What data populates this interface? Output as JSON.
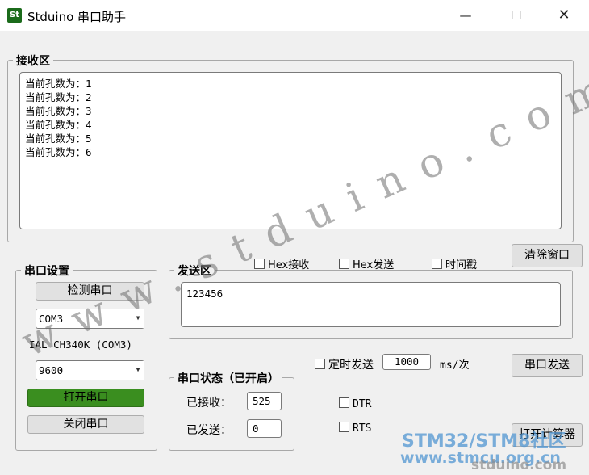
{
  "window": {
    "icon_text": "St",
    "title": "Stduino 串口助手",
    "minimize": "—",
    "maximize": "☐",
    "close": "✕"
  },
  "receive": {
    "title": "接收区",
    "lines": [
      "当前孔数为：1",
      "当前孔数为：2",
      "当前孔数为：3",
      "当前孔数为：4",
      "当前孔数为：5",
      "当前孔数为：6"
    ]
  },
  "clear_button": "清除窗口",
  "options": {
    "hex_receive": "Hex接收",
    "hex_send": "Hex发送",
    "timestamp": "时间戳"
  },
  "serial_settings": {
    "title": "串口设置",
    "detect_button": "检测串口",
    "port_value": "COM3",
    "port_description": "IAL CH340K (COM3)",
    "baud_value": "9600",
    "open_button": "打开串口",
    "close_button": "关闭串口"
  },
  "send": {
    "title": "发送区",
    "text": "123456"
  },
  "timed_send": {
    "label": "定时发送",
    "interval": "1000",
    "unit": "ms/次"
  },
  "send_button": "串口发送",
  "status": {
    "title": "串口状态（已开启）",
    "received_label": "已接收：",
    "received_value": "525",
    "sent_label": "已发送：",
    "sent_value": "0"
  },
  "signals": {
    "dtr": "DTR",
    "rts": "RTS"
  },
  "calculator_button": "打开计算器",
  "watermarks": {
    "diagonal": "www.stduino.com",
    "site_line1": "STM32/STM8社区",
    "site_line2": "www.stmcu.org.cn",
    "site_line3": "stduino.com"
  },
  "colors": {
    "open_button_bg": "#3a8e1f",
    "app_icon_bg": "#1b6b1b"
  }
}
